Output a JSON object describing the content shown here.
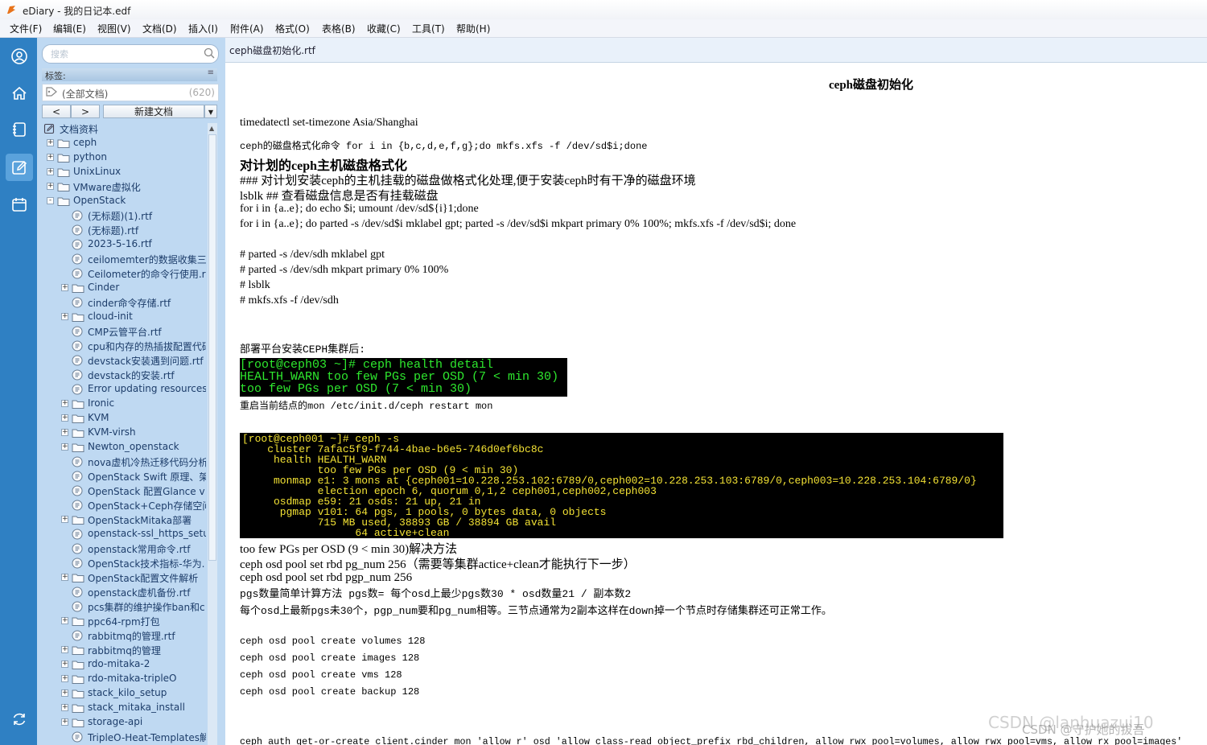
{
  "window": {
    "title": "eDiary - 我的日记本.edf"
  },
  "menu": [
    "文件(F)",
    "编辑(E)",
    "视图(V)",
    "文档(D)",
    "插入(I)",
    "附件(A)",
    "格式(O)",
    "表格(B)",
    "收藏(C)",
    "工具(T)",
    "帮助(H)"
  ],
  "sidebar": {
    "search_placeholder": "搜索",
    "tags_label": "标签:",
    "all_docs": "(全部文档)",
    "all_docs_count": "(620)",
    "prev": "<",
    "next": ">",
    "new_doc": "新建文档",
    "tree": [
      {
        "label": "文档资料",
        "type": "root",
        "level": 0
      },
      {
        "label": "ceph",
        "type": "folder",
        "level": 1,
        "exp": "+"
      },
      {
        "label": "python",
        "type": "folder",
        "level": 1,
        "exp": "+"
      },
      {
        "label": "UnixLinux",
        "type": "folder",
        "level": 1,
        "exp": "+"
      },
      {
        "label": "VMware虚拟化",
        "type": "folder",
        "level": 1,
        "exp": "+"
      },
      {
        "label": "OpenStack",
        "type": "folder",
        "level": 1,
        "exp": "-"
      },
      {
        "label": "(无标题)(1).rtf",
        "type": "file",
        "level": 2
      },
      {
        "label": "(无标题).rtf",
        "type": "file",
        "level": 2
      },
      {
        "label": "2023-5-16.rtf",
        "type": "file",
        "level": 2
      },
      {
        "label": "ceilomemter的数据收集三",
        "type": "file",
        "level": 2
      },
      {
        "label": "Ceilometer的命令行使用.r",
        "type": "file",
        "level": 2
      },
      {
        "label": "Cinder",
        "type": "folder",
        "level": 2,
        "exp": "+"
      },
      {
        "label": "cinder命令存储.rtf",
        "type": "file",
        "level": 2
      },
      {
        "label": "cloud-init",
        "type": "folder",
        "level": 2,
        "exp": "+"
      },
      {
        "label": "CMP云管平台.rtf",
        "type": "file",
        "level": 2
      },
      {
        "label": "cpu和内存的热插拔配置代码",
        "type": "file",
        "level": 2
      },
      {
        "label": "devstack安装遇到问题.rtf",
        "type": "file",
        "level": 2
      },
      {
        "label": "devstack的安装.rtf",
        "type": "file",
        "level": 2
      },
      {
        "label": "Error updating resources",
        "type": "file",
        "level": 2
      },
      {
        "label": "Ironic",
        "type": "folder",
        "level": 2,
        "exp": "+"
      },
      {
        "label": "KVM",
        "type": "folder",
        "level": 2,
        "exp": "+"
      },
      {
        "label": "KVM-virsh",
        "type": "folder",
        "level": 2,
        "exp": "+"
      },
      {
        "label": "Newton_openstack",
        "type": "folder",
        "level": 2,
        "exp": "+"
      },
      {
        "label": "nova虚机冷热迁移代码分析",
        "type": "file",
        "level": 2
      },
      {
        "label": "OpenStack Swift 原理、架",
        "type": "file",
        "level": 2
      },
      {
        "label": "OpenStack 配置Glance v",
        "type": "file",
        "level": 2
      },
      {
        "label": "OpenStack+Ceph存储空间",
        "type": "file",
        "level": 2
      },
      {
        "label": "OpenStackMitaka部署",
        "type": "folder",
        "level": 2,
        "exp": "+"
      },
      {
        "label": "openstack-ssl_https_setu",
        "type": "file",
        "level": 2
      },
      {
        "label": "openstack常用命令.rtf",
        "type": "file",
        "level": 2
      },
      {
        "label": "OpenStack技术指标-华为.",
        "type": "file",
        "level": 2
      },
      {
        "label": "OpenStack配置文件解析",
        "type": "folder",
        "level": 2,
        "exp": "+"
      },
      {
        "label": "openstack虚机备份.rtf",
        "type": "file",
        "level": 2
      },
      {
        "label": "pcs集群的维护操作ban和c",
        "type": "file",
        "level": 2
      },
      {
        "label": "ppc64-rpm打包",
        "type": "folder",
        "level": 2,
        "exp": "+"
      },
      {
        "label": "rabbitmq的管理.rtf",
        "type": "file",
        "level": 2
      },
      {
        "label": "rabbitmq的管理",
        "type": "folder",
        "level": 2,
        "exp": "+"
      },
      {
        "label": "rdo-mitaka-2",
        "type": "folder",
        "level": 2,
        "exp": "+"
      },
      {
        "label": "rdo-mitaka-tripleO",
        "type": "folder",
        "level": 2,
        "exp": "+"
      },
      {
        "label": "stack_kilo_setup",
        "type": "folder",
        "level": 2,
        "exp": "+"
      },
      {
        "label": "stack_mitaka_install",
        "type": "folder",
        "level": 2,
        "exp": "+"
      },
      {
        "label": "storage-api",
        "type": "folder",
        "level": 2,
        "exp": "+"
      },
      {
        "label": "TripleO-Heat-Templates解",
        "type": "file",
        "level": 2
      }
    ]
  },
  "tab": {
    "label": "ceph磁盘初始化.rtf"
  },
  "doc": {
    "title": "ceph磁盘初始化",
    "l1": "timedatectl set-timezone Asia/Shanghai",
    "l2": "ceph的磁盘格式化命令 for i in {b,c,d,e,f,g};do mkfs.xfs -f /dev/sd$i;done",
    "h1": "对计划的ceph主机磁盘格式化",
    "l3": "### 对计划安装ceph的主机挂载的磁盘做格式化处理,便于安装ceph时有干净的磁盘环境",
    "l4": "lsblk ## 查看磁盘信息是否有挂载磁盘",
    "l5": "for i in {a..e}; do echo $i; umount /dev/sd${i}1;done",
    "l6": "for i in {a..e}; do parted -s /dev/sd$i mklabel gpt; parted -s /dev/sd$i mkpart primary 0% 100%; mkfs.xfs -f /dev/sd$i; done",
    "l7": "# parted -s /dev/sdh mklabel gpt",
    "l8": "# parted -s /dev/sdh mkpart primary 0% 100%",
    "l9": "# lsblk",
    "l10": "# mkfs.xfs -f /dev/sdh",
    "l11": "部署平台安装CEPH集群后:",
    "term1": [
      "[root@ceph03 ~]# ceph health detail",
      "HEALTH_WARN too few PGs per OSD (7 < min 30)",
      "too few PGs per OSD (7 < min 30)"
    ],
    "l12": "重启当前结点的mon  /etc/init.d/ceph restart mon",
    "term2": [
      "[root@ceph001 ~]# ceph -s",
      "    cluster 7afac5f9-f744-4bae-b6e5-746d0ef6bc8c",
      "     health HEALTH_WARN",
      "            too few PGs per OSD (9 < min 30)",
      "     monmap e1: 3 mons at {ceph001=10.228.253.102:6789/0,ceph002=10.228.253.103:6789/0,ceph003=10.228.253.104:6789/0}",
      "            election epoch 6, quorum 0,1,2 ceph001,ceph002,ceph003",
      "     osdmap e59: 21 osds: 21 up, 21 in",
      "      pgmap v101: 64 pgs, 1 pools, 0 bytes data, 0 objects",
      "            715 MB used, 38893 GB / 38894 GB avail",
      "                  64 active+clean"
    ],
    "l13": "too few PGs per OSD (9 < min 30)解决方法",
    "l14": "ceph osd pool set rbd pg_num 256（需要等集群actice+clean才能执行下一步）",
    "l15": "ceph osd pool set rbd pgp_num 256",
    "l16": "pgs数量简单计算方法 pgs数= 每个osd上最少pgs数30 * osd数量21 / 副本数2",
    "l17": "每个osd上最新pgs未30个，pgp_num要和pg_num相等。三节点通常为2副本这样在down掉一个节点时存储集群还可正常工作。",
    "l18": "ceph osd pool create volumes 128",
    "l19": "ceph osd pool create images 128",
    "l20": "ceph osd pool create vms 128",
    "l21": "ceph osd pool create backup 128",
    "l22": "ceph auth get-or-create client.cinder mon 'allow r' osd 'allow class-read object_prefix rbd_children, allow rwx pool=volumes, allow rwx pool=vms, allow rx pool=images'"
  },
  "watermark": "CSDN @lanhuazui10",
  "watermark2": "CSDN @守护她的拔吾",
  "colors": {
    "accent": "#2f80c3",
    "sidebar": "#bfd9f2",
    "term_green": "#2ee82e",
    "term_yellow": "#f3e234"
  }
}
